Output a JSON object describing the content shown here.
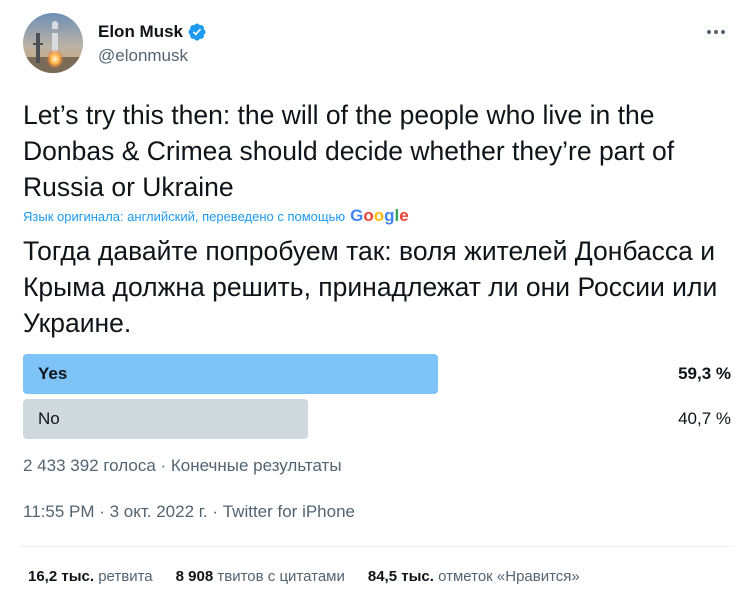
{
  "author": {
    "name": "Elon Musk",
    "handle": "@elonmusk"
  },
  "tweet": {
    "text": "Let’s try this then: the will of the people who live in the Donbas & Crimea should decide whether they’re part of Russia or Ukraine",
    "translation_note": "Язык оригинала: английский, переведено с помощью",
    "translation_provider": "Google",
    "translated_text": "Тогда давайте попробуем так: воля жителей Донбасса и Крыма должна решить, принадлежат ли они России или Украине."
  },
  "poll": {
    "options": [
      {
        "label": "Yes",
        "percent_text": "59,3 %",
        "percent": 59.3,
        "winner": true
      },
      {
        "label": "No",
        "percent_text": "40,7 %",
        "percent": 40.7,
        "winner": false
      }
    ],
    "meta": "2 433 392 голоса · Конечные результаты"
  },
  "timestamp": "11:55 PM · 3 окт. 2022 г. · Twitter for iPhone",
  "stats": {
    "retweets_value": "16,2 тыс.",
    "retweets_label": "ретвита",
    "quotes_value": "8 908",
    "quotes_label": "твитов с цитатами",
    "likes_value": "84,5 тыс.",
    "likes_label": "отметок «Нравится»"
  },
  "colors": {
    "accent": "#1d9bf0",
    "poll_winner": "#7dc3f7",
    "poll_loser": "#cfd9de",
    "secondary_text": "#536471"
  },
  "icons": {
    "verified": "verified-badge-icon",
    "more": "more-options-icon",
    "avatar": "starship-launch-avatar"
  }
}
